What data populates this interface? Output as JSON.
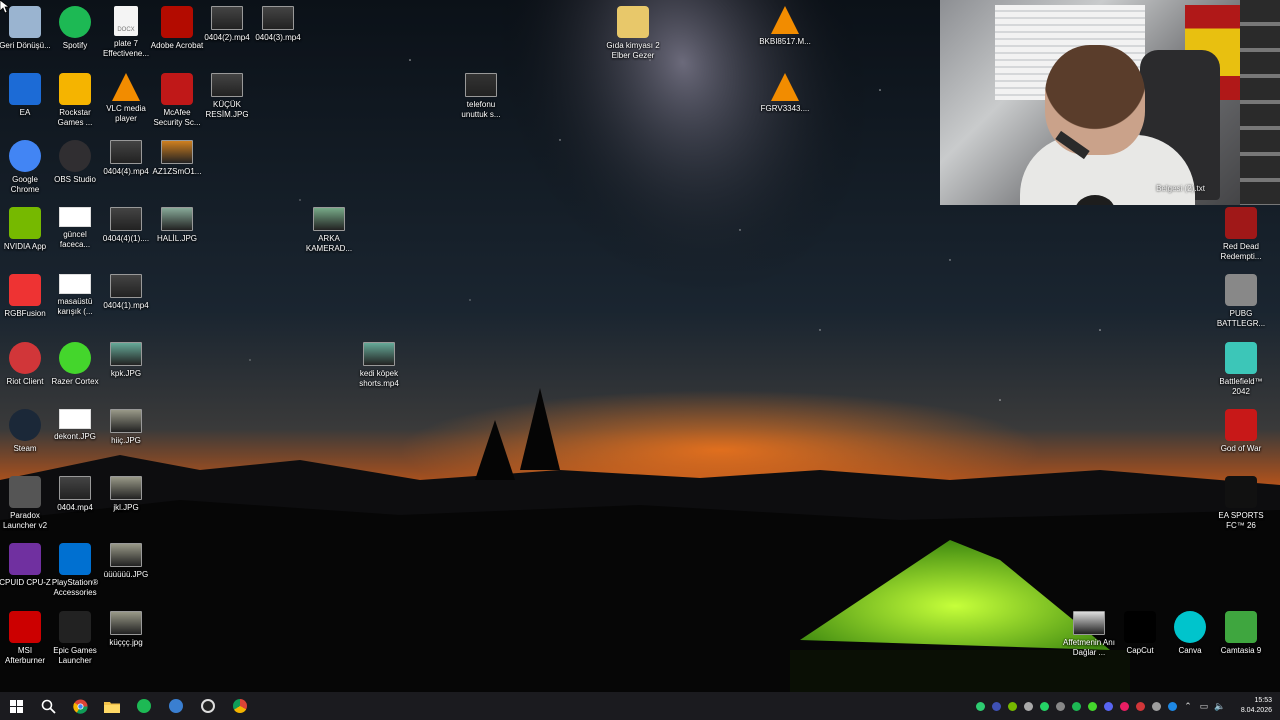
{
  "desktop_icons": [
    {
      "label": "Geri Dönüşü...",
      "icon": "recycle-bin-icon",
      "color": "#9ab4d0"
    },
    {
      "label": "Spotify",
      "icon": "spotify-icon",
      "color": "#1db954"
    },
    {
      "label": "plate 7 Effectivene...",
      "icon": "document-icon",
      "color": "#f4f4f4"
    },
    {
      "label": "Adobe Acrobat",
      "icon": "acrobat-icon",
      "color": "#b30b00"
    },
    {
      "label": "0404(2).mp4",
      "icon": "video-thumbnail-icon",
      "color": "#444"
    },
    {
      "label": "0404(3).mp4",
      "icon": "video-thumbnail-icon",
      "color": "#444"
    },
    {
      "label": "Gıda kimyası 2 Elber Gezer",
      "icon": "folder-icon",
      "color": "#e8c86a"
    },
    {
      "label": "BKBI8517.M...",
      "icon": "vlc-icon",
      "color": "#f28c00"
    },
    {
      "label": "EA",
      "icon": "ea-icon",
      "color": "#1c6bd6"
    },
    {
      "label": "Rockstar Games ...",
      "icon": "rockstar-icon",
      "color": "#f5b400"
    },
    {
      "label": "VLC media player",
      "icon": "vlc-icon",
      "color": "#f28c00"
    },
    {
      "label": "McAfee Security Sc...",
      "icon": "mcafee-icon",
      "color": "#c01818"
    },
    {
      "label": "KÜÇÜK RESİM.JPG",
      "icon": "image-thumbnail-icon",
      "color": "#444"
    },
    {
      "label": "telefonu unuttuk s...",
      "icon": "video-thumbnail-icon",
      "color": "#333"
    },
    {
      "label": "FGRV3343....",
      "icon": "vlc-icon",
      "color": "#f28c00"
    },
    {
      "label": "Google Chrome",
      "icon": "chrome-icon",
      "color": "#4285f4"
    },
    {
      "label": "OBS Studio",
      "icon": "obs-icon",
      "color": "#302e31"
    },
    {
      "label": "0404(4).mp4",
      "icon": "video-thumbnail-icon",
      "color": "#444"
    },
    {
      "label": "AZ1ZSmO1...",
      "icon": "image-thumbnail-icon",
      "color": "#d08020"
    },
    {
      "label": "NVIDIA App",
      "icon": "nvidia-icon",
      "color": "#76b900"
    },
    {
      "label": "güncel faceca...",
      "icon": "blank-image-icon",
      "color": "#ffffff"
    },
    {
      "label": "0404(4)(1)....",
      "icon": "video-thumbnail-icon",
      "color": "#444"
    },
    {
      "label": "HALİL.JPG",
      "icon": "image-thumbnail-icon",
      "color": "#8a9"
    },
    {
      "label": "ARKA KAMERAD...",
      "icon": "image-thumbnail-icon",
      "color": "#7a8"
    },
    {
      "label": "RGBFusion",
      "icon": "rgbfusion-icon",
      "color": "#e33"
    },
    {
      "label": "masaüstü karışık (...",
      "icon": "blank-image-icon",
      "color": "#ffffff"
    },
    {
      "label": "0404(1).mp4",
      "icon": "video-thumbnail-icon",
      "color": "#444"
    },
    {
      "label": "Riot Client",
      "icon": "riot-icon",
      "color": "#d13639"
    },
    {
      "label": "Razer Cortex",
      "icon": "razer-icon",
      "color": "#44d62c"
    },
    {
      "label": "kpk.JPG",
      "icon": "image-thumbnail-icon",
      "color": "#6a9"
    },
    {
      "label": "kedi köpek shorts.mp4",
      "icon": "video-thumbnail-icon",
      "color": "#6a9"
    },
    {
      "label": "Steam",
      "icon": "steam-icon",
      "color": "#1b2838"
    },
    {
      "label": "dekont.JPG",
      "icon": "blank-image-icon",
      "color": "#ffffff"
    },
    {
      "label": "hiiç.JPG",
      "icon": "image-thumbnail-icon",
      "color": "#998"
    },
    {
      "label": "Paradox Launcher v2",
      "icon": "paradox-icon",
      "color": "#555"
    },
    {
      "label": "0404.mp4",
      "icon": "video-thumbnail-icon",
      "color": "#444"
    },
    {
      "label": "jkl.JPG",
      "icon": "image-thumbnail-icon",
      "color": "#998"
    },
    {
      "label": "CPUID CPU-Z",
      "icon": "cpuz-icon",
      "color": "#7030a0"
    },
    {
      "label": "PlayStation® Accessories",
      "icon": "playstation-icon",
      "color": "#0070d1"
    },
    {
      "label": "üüüüüü.JPG",
      "icon": "image-thumbnail-icon",
      "color": "#998"
    },
    {
      "label": "MSI Afterburner",
      "icon": "msi-icon",
      "color": "#c00"
    },
    {
      "label": "Epic Games Launcher",
      "icon": "epic-games-icon",
      "color": "#222"
    },
    {
      "label": "küççç.jpg",
      "icon": "image-thumbnail-icon",
      "color": "#998"
    },
    {
      "label": "Red Dead Redempti...",
      "icon": "rdr-icon",
      "color": "#a01818"
    },
    {
      "label": "PUBG BATTLEGR...",
      "icon": "pubg-icon",
      "color": "#888"
    },
    {
      "label": "Battlefield™ 2042",
      "icon": "battlefield-icon",
      "color": "#3cc6b8"
    },
    {
      "label": "God of War",
      "icon": "god-of-war-icon",
      "color": "#c81818"
    },
    {
      "label": "EA SPORTS FC™ 26",
      "icon": "ea-fc-icon",
      "color": "#111"
    },
    {
      "label": "Affetmenin Anı Dağlar ...",
      "icon": "image-thumbnail-icon",
      "color": "#ddd"
    },
    {
      "label": "CapCut",
      "icon": "capcut-icon",
      "color": "#000"
    },
    {
      "label": "Canva",
      "icon": "canva-icon",
      "color": "#00c4cc"
    },
    {
      "label": "Camtasia 9",
      "icon": "camtasia-icon",
      "color": "#3fa63f"
    }
  ],
  "webcam_overlay": {
    "caption": "Belgesi (2).txt"
  },
  "taskbar": {
    "apps": [
      {
        "name": "start",
        "icon": "windows-start-icon"
      },
      {
        "name": "search",
        "icon": "search-icon"
      },
      {
        "name": "chrome",
        "icon": "chrome-icon",
        "color": "#4285f4"
      },
      {
        "name": "file-explorer",
        "icon": "folder-icon",
        "color": "#f3c24b"
      },
      {
        "name": "spotify",
        "icon": "spotify-icon",
        "color": "#1db954"
      },
      {
        "name": "steam",
        "icon": "steam-icon",
        "color": "#3a7fd1"
      },
      {
        "name": "obs",
        "icon": "obs-icon",
        "color": "#ddd"
      },
      {
        "name": "chrome-profile",
        "icon": "chrome-icon",
        "color": "#e74c3c"
      }
    ],
    "clock": {
      "time": "15:53",
      "date": "8.04.2026"
    }
  },
  "colors": {
    "taskbar_bg": "#1b1b1f",
    "sky_top": "#0b1118",
    "horizon_glow": "#c2541a",
    "tent": "#7ed321"
  }
}
